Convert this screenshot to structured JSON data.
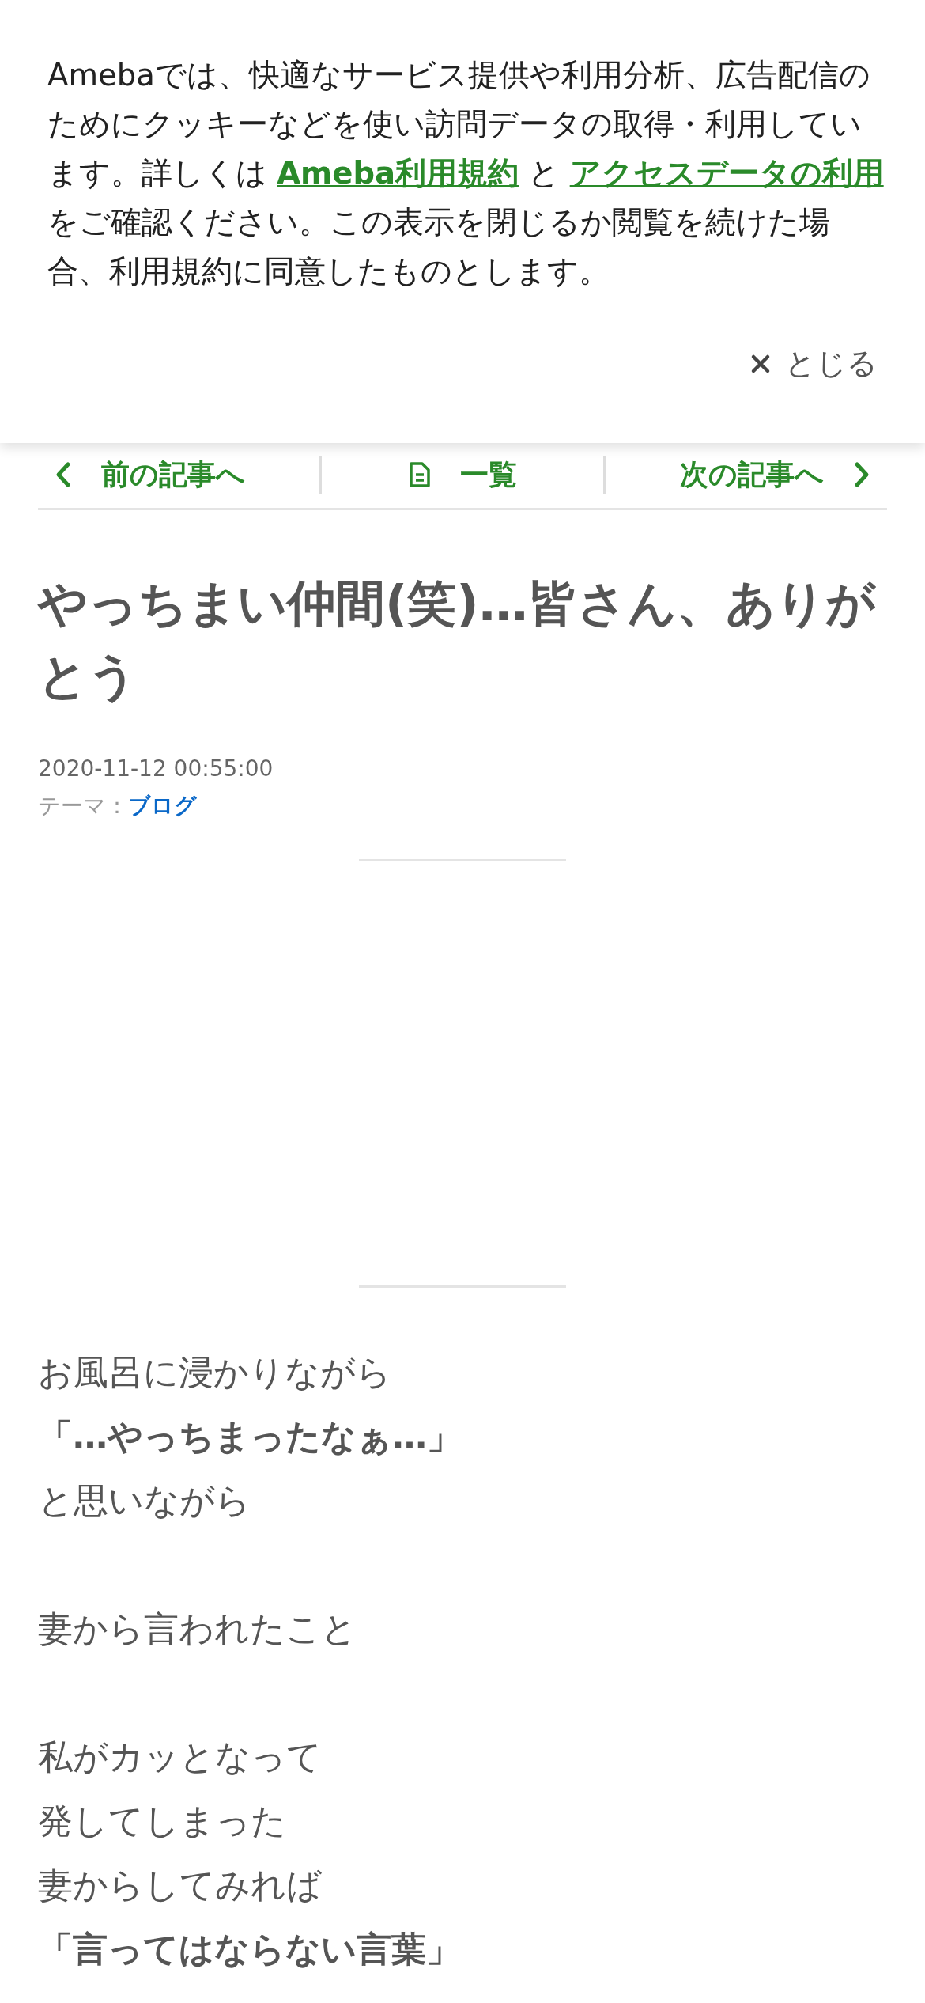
{
  "cookie_banner": {
    "segments": [
      {
        "kind": "text",
        "text": "Amebaでは、快適なサービス提供や利用分析、広告配信のためにクッキーなどを使い訪問データの取得・利用しています。詳しくは "
      },
      {
        "kind": "link",
        "text": "Ameba利用規約"
      },
      {
        "kind": "text",
        "text": " と "
      },
      {
        "kind": "link",
        "text": "アクセスデータの利用"
      },
      {
        "kind": "text",
        "text": " をご確認ください。この表示を閉じるか閲覧を続けた場合、利用規約に同意したものとします。"
      }
    ],
    "close_label": "とじる"
  },
  "article_nav": {
    "prev": "前の記事へ",
    "list": "一覧",
    "next": "次の記事へ"
  },
  "article": {
    "title": "やっちまい仲間(笑)…皆さん、ありがとう",
    "date": "2020-11-12 00:55:00",
    "theme_label": "テーマ：",
    "theme": "ブログ",
    "paragraphs": [
      [
        {
          "text": "お風呂に浸かりながら",
          "bold": false
        },
        {
          "text": "「…やっちまったなぁ…」",
          "bold": true
        },
        {
          "text": "と思いながら",
          "bold": false
        }
      ],
      [
        {
          "text": "妻から言われたこと",
          "bold": false
        }
      ],
      [
        {
          "text": "私がカッとなって",
          "bold": false
        },
        {
          "text": "発してしまった",
          "bold": false
        },
        {
          "text": "妻からしてみれば",
          "bold": false
        },
        {
          "text": "「言ってはならない言葉」",
          "bold": true
        }
      ]
    ]
  }
}
